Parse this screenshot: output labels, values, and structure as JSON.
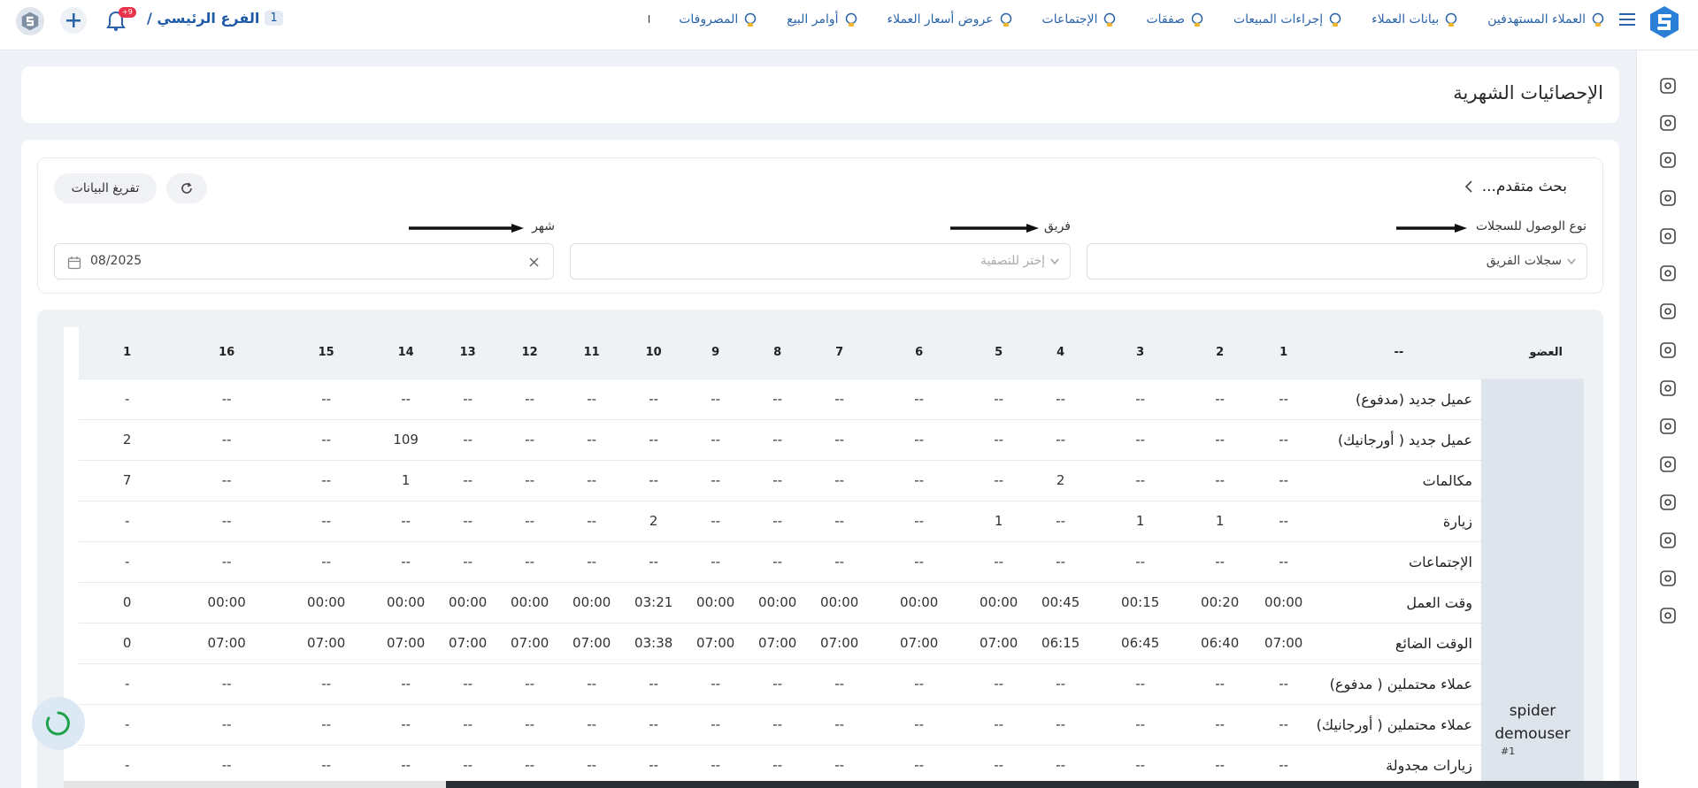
{
  "topbar": {
    "nav_items": [
      {
        "label": "العملاء المستهدفين",
        "icon": "target-customers-icon"
      },
      {
        "label": "بيانات العملاء",
        "icon": "customer-data-icon"
      },
      {
        "label": "إجراءات المبيعات",
        "icon": "sales-actions-icon"
      },
      {
        "label": "صفقات",
        "icon": "deals-icon"
      },
      {
        "label": "الإجتماعات",
        "icon": "meetings-icon"
      },
      {
        "label": "عروض أسعار العملاء",
        "icon": "quotes-icon"
      },
      {
        "label": "أوامر البيع",
        "icon": "sales-orders-icon"
      },
      {
        "label": "المصروفات",
        "icon": "expenses-icon"
      }
    ],
    "nav_more": "ا",
    "branch_title": "الفرع الرئيسي /",
    "branch_badge": "1",
    "notifications_badge": "+9"
  },
  "page": {
    "title": "الإحصائيات الشهرية"
  },
  "filters": {
    "advanced_search": "بحث متقدم...",
    "export_label": "تفريغ البيانات",
    "access_type_label": "نوع الوصول للسجلات",
    "access_type_value": "سجلات الفريق",
    "team_label": "فريق",
    "team_placeholder": "إختر للتصفية",
    "month_label": "شهر",
    "month_value": "08/2025"
  },
  "table": {
    "member_header": "العضو",
    "label_header": "--",
    "days": [
      "1",
      "2",
      "3",
      "4",
      "5",
      "6",
      "7",
      "8",
      "9",
      "10",
      "11",
      "12",
      "13",
      "14",
      "15",
      "16",
      "1"
    ],
    "member": {
      "name": "spider demouser",
      "id": "#1"
    },
    "rows": [
      {
        "label": "عميل جديد (مدفوع)",
        "values": [
          "--",
          "--",
          "--",
          "--",
          "--",
          "--",
          "--",
          "--",
          "--",
          "--",
          "--",
          "--",
          "--",
          "--",
          "--",
          "--",
          "-"
        ]
      },
      {
        "label": "عميل جديد ( أورجانيك)",
        "values": [
          "--",
          "--",
          "--",
          "--",
          "--",
          "--",
          "--",
          "--",
          "--",
          "--",
          "--",
          "--",
          "--",
          "109",
          "--",
          "--",
          "2"
        ]
      },
      {
        "label": "مكالمات",
        "values": [
          "--",
          "--",
          "--",
          "2",
          "--",
          "--",
          "--",
          "--",
          "--",
          "--",
          "--",
          "--",
          "--",
          "1",
          "--",
          "--",
          "7"
        ]
      },
      {
        "label": "زيارة",
        "values": [
          "--",
          "1",
          "1",
          "--",
          "1",
          "--",
          "--",
          "--",
          "--",
          "2",
          "--",
          "--",
          "--",
          "--",
          "--",
          "--",
          "-"
        ]
      },
      {
        "label": "الإجتماعات",
        "values": [
          "--",
          "--",
          "--",
          "--",
          "--",
          "--",
          "--",
          "--",
          "--",
          "--",
          "--",
          "--",
          "--",
          "--",
          "--",
          "--",
          "-"
        ]
      },
      {
        "label": "وقت العمل",
        "values": [
          "00:00",
          "00:20",
          "00:15",
          "00:45",
          "00:00",
          "00:00",
          "00:00",
          "00:00",
          "00:00",
          "03:21",
          "00:00",
          "00:00",
          "00:00",
          "00:00",
          "00:00",
          "00:00",
          "0"
        ]
      },
      {
        "label": "الوقت الضائع",
        "values": [
          "07:00",
          "06:40",
          "06:45",
          "06:15",
          "07:00",
          "07:00",
          "07:00",
          "07:00",
          "07:00",
          "03:38",
          "07:00",
          "07:00",
          "07:00",
          "07:00",
          "07:00",
          "07:00",
          "0"
        ]
      },
      {
        "label": "عملاء محتملين ( مدفوع)",
        "values": [
          "--",
          "--",
          "--",
          "--",
          "--",
          "--",
          "--",
          "--",
          "--",
          "--",
          "--",
          "--",
          "--",
          "--",
          "--",
          "--",
          "-"
        ]
      },
      {
        "label": "عملاء محتملين ( أورجانيك)",
        "values": [
          "--",
          "--",
          "--",
          "--",
          "--",
          "--",
          "--",
          "--",
          "--",
          "--",
          "--",
          "--",
          "--",
          "--",
          "--",
          "--",
          "-"
        ]
      },
      {
        "label": "زيارات مجدولة",
        "values": [
          "--",
          "--",
          "--",
          "--",
          "--",
          "--",
          "--",
          "--",
          "--",
          "--",
          "--",
          "--",
          "--",
          "--",
          "--",
          "--",
          "-"
        ]
      }
    ]
  },
  "sidebar_icons": [
    "users-icon",
    "building-icon",
    "handshake-icon",
    "phone-icon",
    "location-icon",
    "telephone-icon",
    "calendar-add-icon",
    "team-icon",
    "money-icon",
    "warning-icon",
    "video-icon",
    "chart-icon",
    "invoice-icon",
    "signature-icon",
    "printer-icon"
  ],
  "colors": {
    "brand": "#1f5aa6",
    "accent": "#2a63a8",
    "badge": "#e8334a"
  }
}
